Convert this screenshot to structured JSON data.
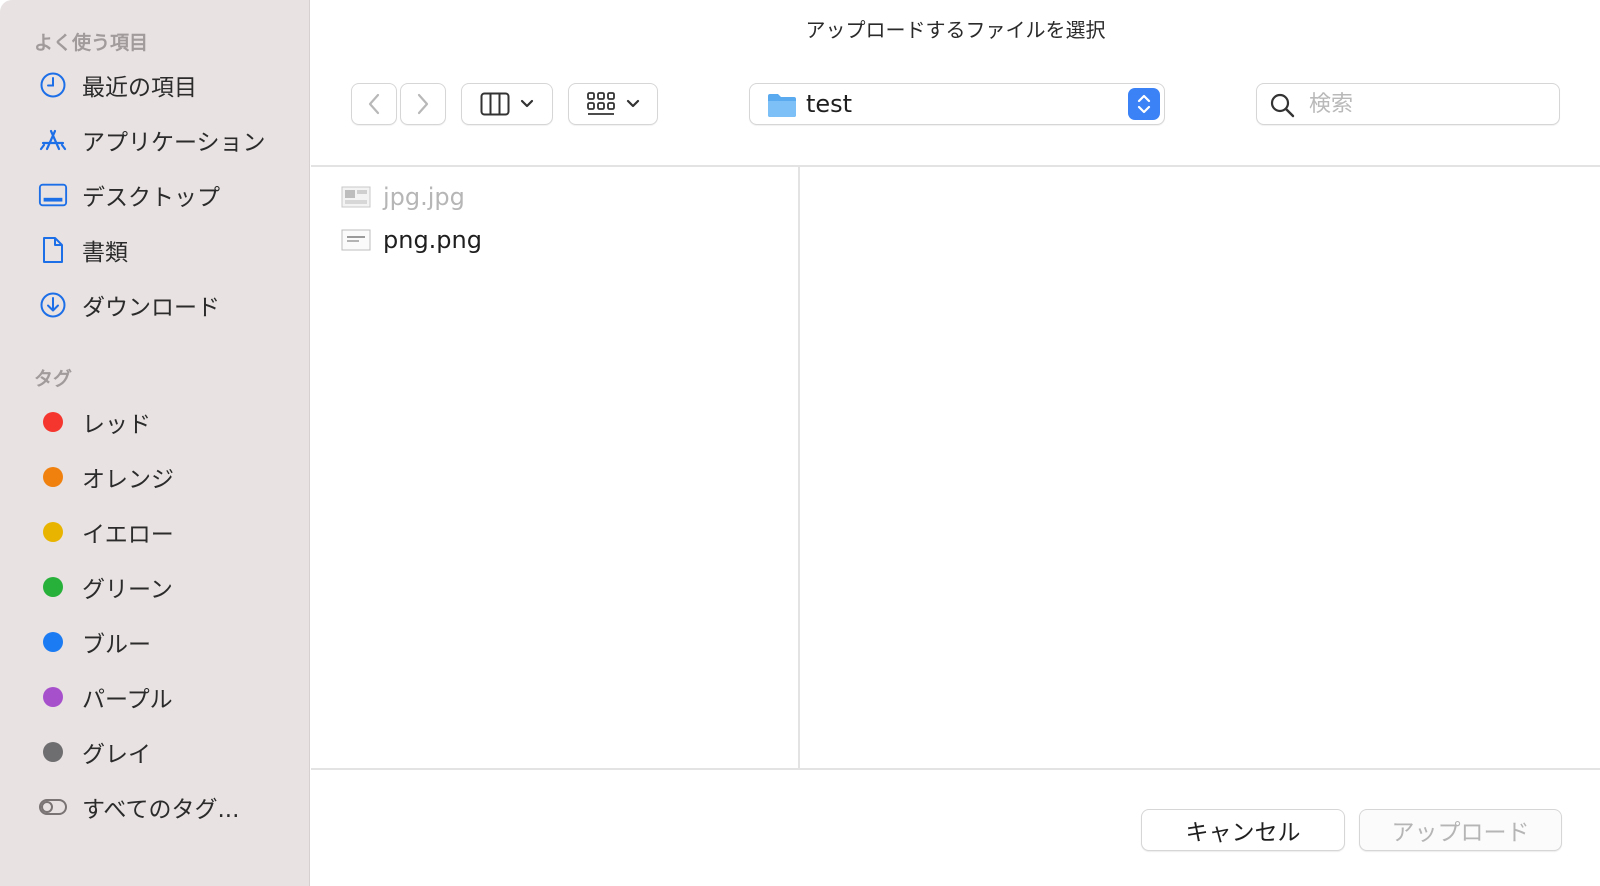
{
  "sidebar": {
    "favorites_title": "よく使う項目",
    "favorites": [
      {
        "label": "最近の項目",
        "icon": "clock-icon"
      },
      {
        "label": "アプリケーション",
        "icon": "applications-icon"
      },
      {
        "label": "デスクトップ",
        "icon": "desktop-icon"
      },
      {
        "label": "書類",
        "icon": "document-icon"
      },
      {
        "label": "ダウンロード",
        "icon": "download-icon"
      }
    ],
    "tags_title": "タグ",
    "tags": [
      {
        "label": "レッド",
        "color": "#f5362e"
      },
      {
        "label": "オレンジ",
        "color": "#f0810f"
      },
      {
        "label": "イエロー",
        "color": "#e8b400"
      },
      {
        "label": "グリーン",
        "color": "#27b13b"
      },
      {
        "label": "ブルー",
        "color": "#1b7bf2"
      },
      {
        "label": "パープル",
        "color": "#a750cc"
      },
      {
        "label": "グレイ",
        "color": "#6e6e70"
      }
    ],
    "all_tags": "すべてのタグ..."
  },
  "dialog": {
    "title": "アップロードするファイルを選択",
    "current_folder": "test",
    "search_placeholder": "検索",
    "search_value": ""
  },
  "files": [
    {
      "name": "jpg.jpg",
      "enabled": false
    },
    {
      "name": "png.png",
      "enabled": true
    }
  ],
  "buttons": {
    "cancel": "キャンセル",
    "upload": "アップロード"
  },
  "colors": {
    "accent": "#3b82f6",
    "sidebar_bg": "#e8e2e2",
    "icon_blue": "#1d6fe8"
  }
}
